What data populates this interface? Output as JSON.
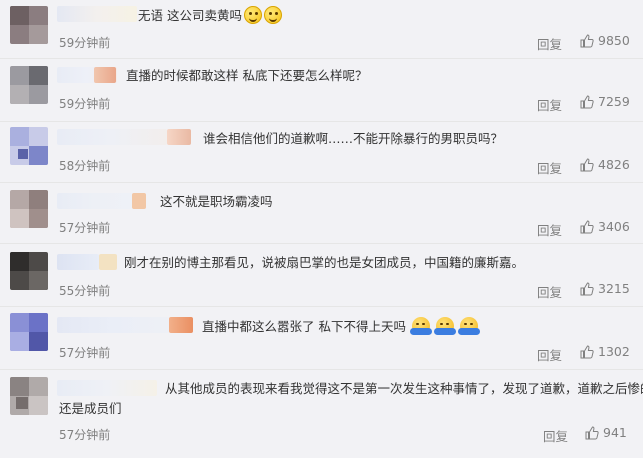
{
  "reply_label": "回复",
  "comments": [
    {
      "text": "无语 这公司卖黄吗",
      "time": "59分钟前",
      "likes": "9850",
      "emojis": [
        "smile",
        "smile"
      ],
      "text2": ""
    },
    {
      "text": "直播的时候都敢这样 私底下还要怎么样呢？",
      "time": "59分钟前",
      "likes": "7259",
      "emojis": [],
      "text2": ""
    },
    {
      "text": "谁会相信他们的道歉啊……不能开除暴行的男职员吗？",
      "time": "58分钟前",
      "likes": "4826",
      "emojis": [],
      "text2": ""
    },
    {
      "text": "这不就是职场霸凌吗",
      "time": "57分钟前",
      "likes": "3406",
      "emojis": [],
      "text2": ""
    },
    {
      "text": "刚才在别的博主那看见，说被扇巴掌的也是女团成员，中国籍的廉斯嘉。",
      "time": "55分钟前",
      "likes": "3215",
      "emojis": [],
      "text2": ""
    },
    {
      "text": "直播中都这么嚣张了 私下不得上天吗",
      "time": "57分钟前",
      "likes": "1302",
      "emojis": [
        "hug",
        "hug",
        "hug"
      ],
      "text2": ""
    },
    {
      "text": "从其他成员的表现来看我觉得这不是第一次发生这种事情了，发现了道歉，道歉之后惨的",
      "time": "57分钟前",
      "likes": "941",
      "emojis": [],
      "text2": "还是成员们"
    }
  ],
  "colors": {
    "background": "#f2f2f5",
    "text": "#333333",
    "meta": "#808080",
    "separator": "#e6e6e6"
  },
  "icons": {
    "like": "thumbs-up-icon"
  }
}
